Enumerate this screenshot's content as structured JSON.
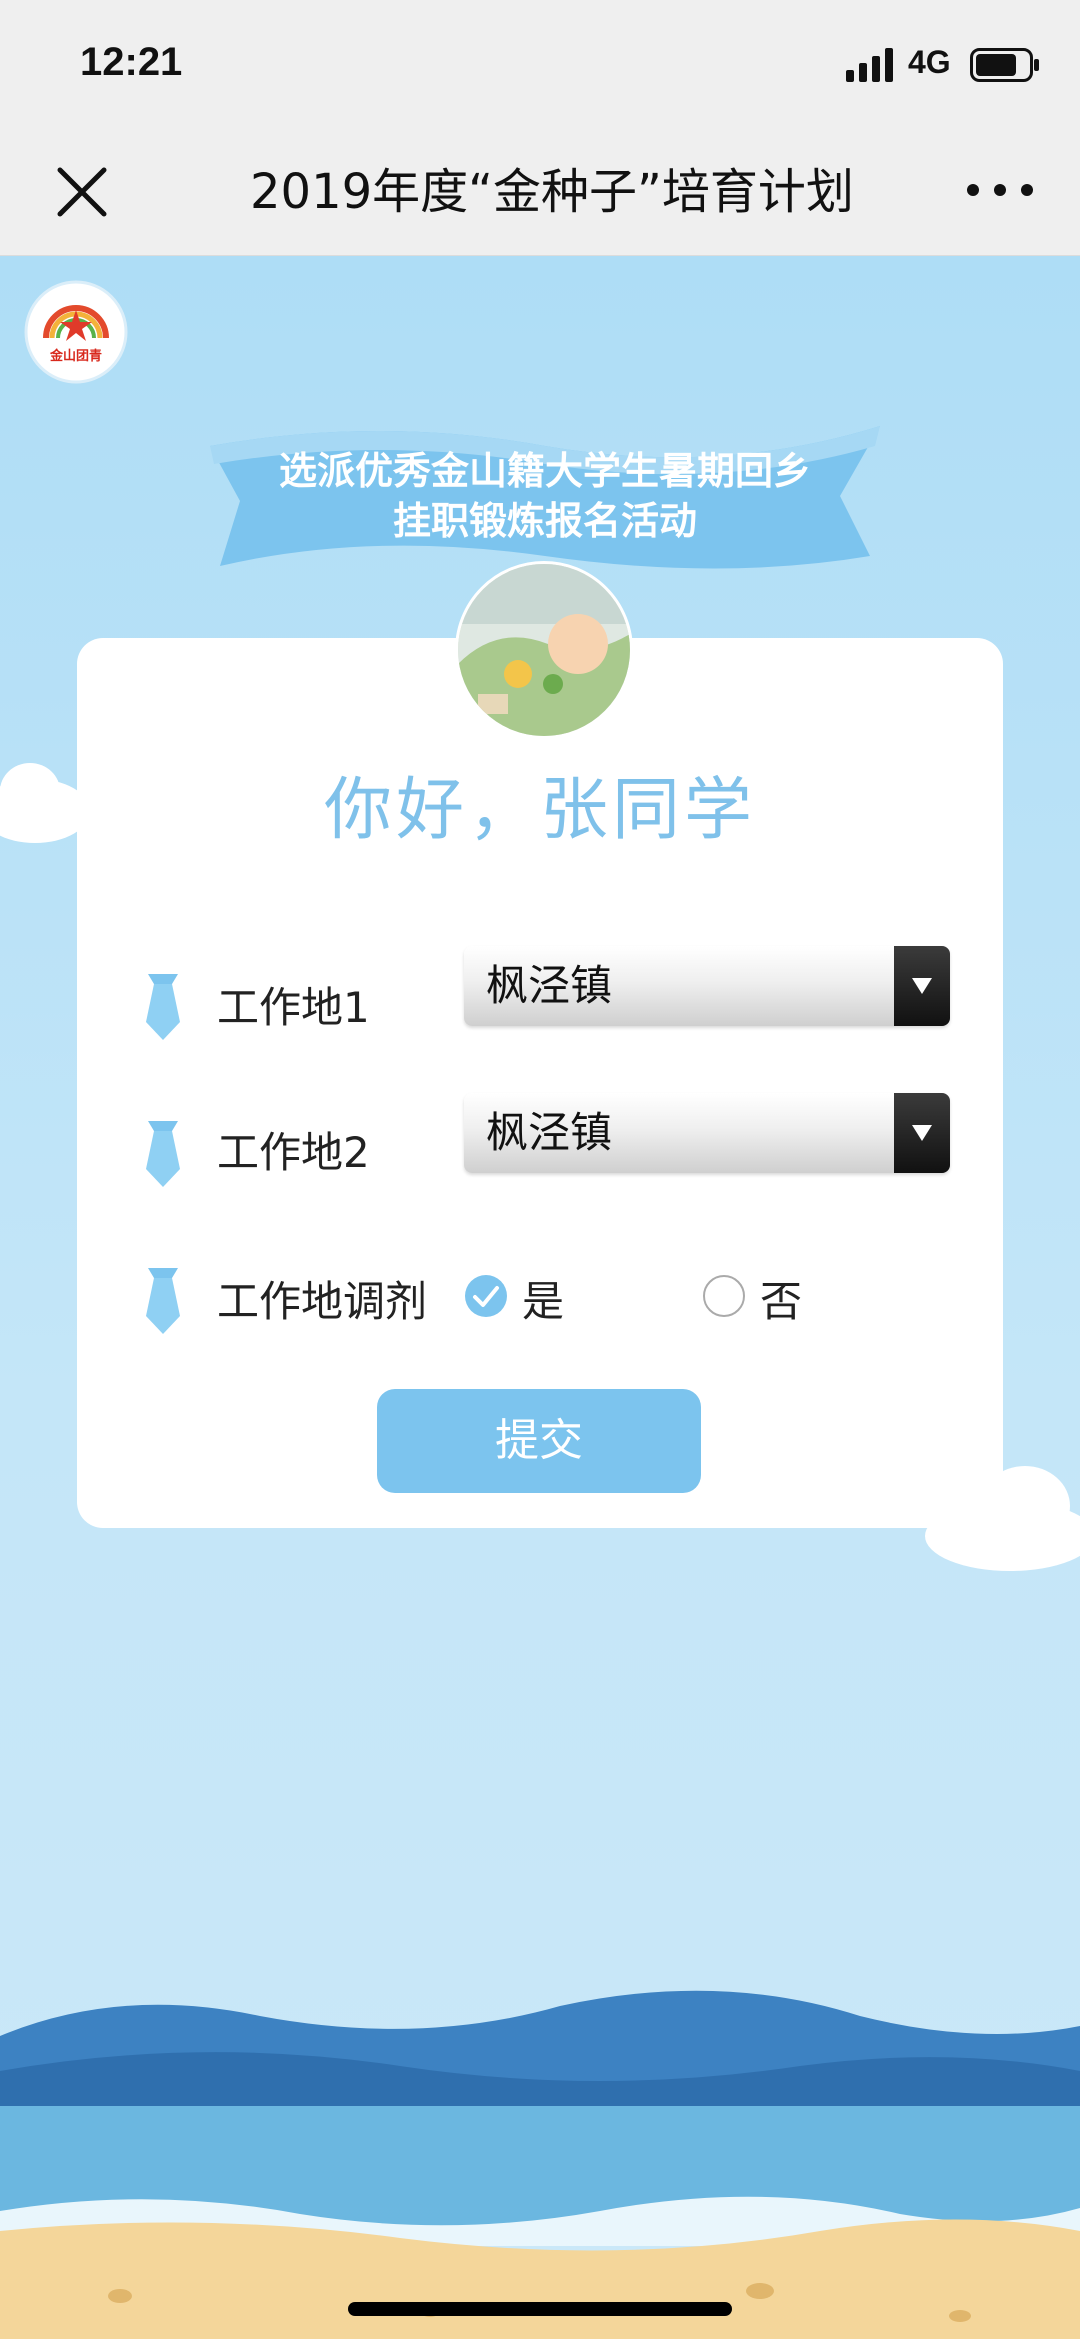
{
  "status_bar": {
    "time": "12:21",
    "network": "4G"
  },
  "nav": {
    "title": "2019年度“金种子”培育计划"
  },
  "logo": {
    "text": "金山团青"
  },
  "banner": {
    "line1": "选派优秀金山籍大学生暑期回乡",
    "line2": "挂职锻炼报名活动"
  },
  "greeting": "你好，张同学",
  "form": {
    "workplace1": {
      "label": "工作地1",
      "value": "枫泾镇"
    },
    "workplace2": {
      "label": "工作地2",
      "value": "枫泾镇"
    },
    "adjust": {
      "label": "工作地调剂",
      "options": [
        {
          "label": "是",
          "checked": true
        },
        {
          "label": "否",
          "checked": false
        }
      ]
    },
    "submit_label": "提交"
  },
  "colors": {
    "accent": "#7cc4ee",
    "greeting": "#7fc1ea",
    "background": "#bfe3f7"
  }
}
